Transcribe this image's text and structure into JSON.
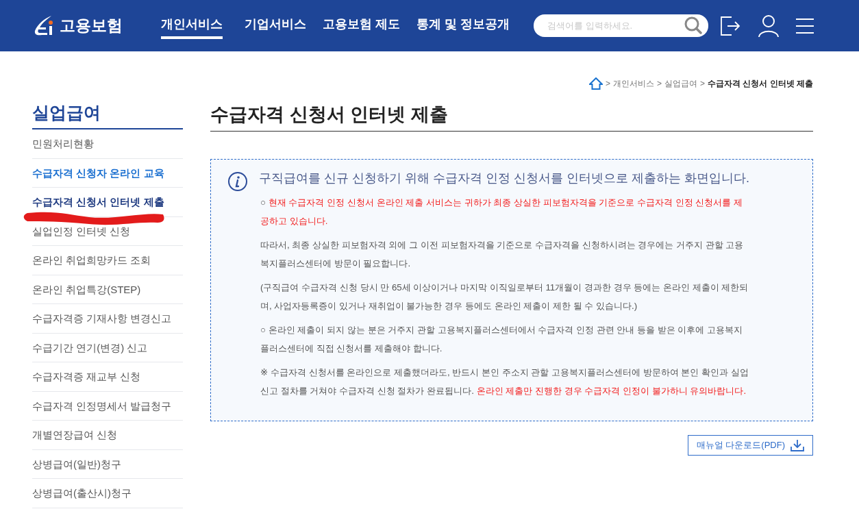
{
  "header": {
    "logo": "고용보험",
    "nav": [
      {
        "label": "개인서비스",
        "selected": true
      },
      {
        "label": "기업서비스",
        "selected": false
      },
      {
        "label": "고용보험 제도",
        "selected": false
      },
      {
        "label": "통계 및 정보공개",
        "selected": false
      }
    ],
    "search": {
      "placeholder": "검색어를 입력하세요."
    }
  },
  "breadcrumb": [
    {
      "separator": ">",
      "label": "개인서비스"
    },
    {
      "separator": ">",
      "label": "실업급여"
    },
    {
      "separator": ">",
      "label": "수급자격 신청서 인터넷 제출"
    }
  ],
  "sidebar": {
    "title": "실업급여",
    "items": [
      {
        "label": "민원처리현황",
        "selected": false,
        "kind": "plain"
      },
      {
        "label": "수급자격 신청자 온라인 교육",
        "selected": false,
        "kind": "highlight"
      },
      {
        "label": "수급자격 신청서 인터넷 제출",
        "selected": true,
        "kind": "plain"
      },
      {
        "label": "실업인정 인터넷 신청",
        "selected": false,
        "kind": "plain"
      },
      {
        "label": "온라인 취업희망카드 조회",
        "selected": false,
        "kind": "plain"
      },
      {
        "label": "온라인 취업특강(STEP)",
        "selected": false,
        "kind": "plain"
      },
      {
        "label": "수급자격증 기재사항 변경신고",
        "selected": false,
        "kind": "plain"
      },
      {
        "label": "수급기간 연기(변경) 신고",
        "selected": false,
        "kind": "plain"
      },
      {
        "label": "수급자격증 재교부 신청",
        "selected": false,
        "kind": "plain"
      },
      {
        "label": "수급자격 인정명세서 발급청구",
        "selected": false,
        "kind": "plain"
      },
      {
        "label": "개별연장급여 신청",
        "selected": false,
        "kind": "plain"
      },
      {
        "label": "상병급여(일반)청구",
        "selected": false,
        "kind": "plain"
      },
      {
        "label": "상병급여(출산시)청구",
        "selected": false,
        "kind": "plain"
      }
    ]
  },
  "page_title": "수급자격 신청서 인터넷 제출",
  "notice": {
    "lead": "구직급여를 신규 신청하기 위해 수급자격 인정 신청서를 인터넷으로 제출하는 화면입니다.",
    "paragraphs": [
      [
        {
          "text": "○ ",
          "warning": false
        },
        {
          "text": "현재 수급자격 인정 신청서 온라인 제출 서비스는 귀하가 최종 상실한 피보험자격을 기준으로 수급자격 인정 신청서를 제공하고 있습니다.",
          "warning": true
        }
      ],
      [
        {
          "text": "따라서, 최종 상실한 피보험자격 외에 그 이전 피보험자격을 기준으로 수급자격을 신청하시려는 경우에는 거주지 관할 고용복지플러스센터에 방문이 필요합니다.",
          "warning": false
        }
      ],
      [
        {
          "text": "(구직급여 수급자격 신청 당시 만 65세 이상이거나 마지막 이직일로부터 11개월이 경과한 경우 등에는 온라인 제출이 제한되며, 사업자등록증이 있거나 재취업이 불가능한 경우 등에도 온라인 제출이 제한 될 수 있습니다.)",
          "warning": false
        }
      ],
      [
        {
          "text": "○ 온라인 제출이 되지 않는 분은 거주지 관할 고용복지플러스센터에서 수급자격 인정 관련 안내 등을 받은 이후에 고용복지플러스센터에 직접 신청서를 제출해야 합니다.",
          "warning": false
        }
      ],
      [
        {
          "text": "※ 수급자격 신청서를 온라인으로 제출했더라도, 반드시 본인 주소지 관할 고용복지플러스센터에 방문하여 본인 확인과 실업신고 절차를 거쳐야 수급자격 신청 절차가 완료됩니다. ",
          "warning": false
        },
        {
          "text": "온라인 제출만 진행한 경우 수급자격 인정이 불가하니 유의바랍니다.",
          "warning": true
        }
      ]
    ]
  },
  "download_button": "매뉴얼 다운로드(PDF)"
}
